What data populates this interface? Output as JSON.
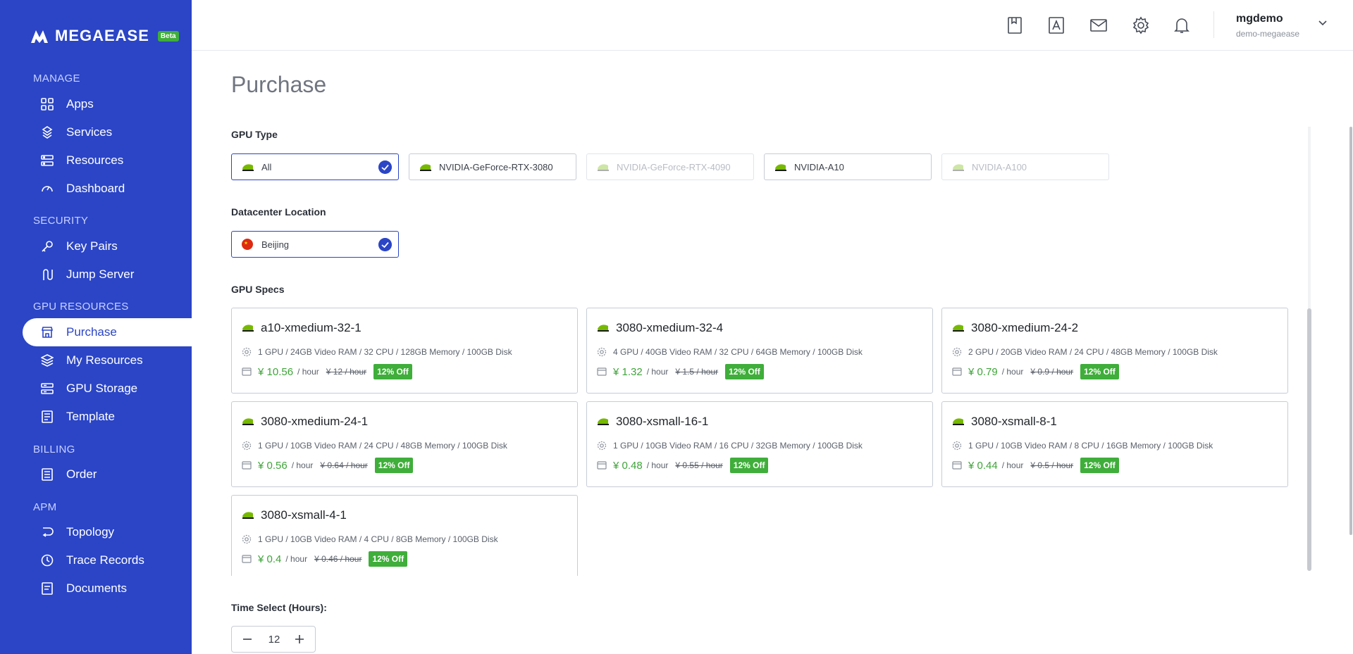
{
  "brand": {
    "name": "MEGAEASE",
    "badge": "Beta"
  },
  "sidebar": {
    "sections": [
      {
        "label": "MANAGE"
      },
      {
        "label": "SECURITY"
      },
      {
        "label": "GPU RESOURCES"
      },
      {
        "label": "BILLING"
      },
      {
        "label": "APM"
      }
    ],
    "items": [
      {
        "label": "Apps",
        "icon": "grid-icon"
      },
      {
        "label": "Services",
        "icon": "services-icon"
      },
      {
        "label": "Resources",
        "icon": "server-icon"
      },
      {
        "label": "Dashboard",
        "icon": "gauge-icon"
      },
      {
        "label": "Key Pairs",
        "icon": "key-icon"
      },
      {
        "label": "Jump Server",
        "icon": "jump-server-icon"
      },
      {
        "label": "Purchase",
        "icon": "store-icon",
        "active": true
      },
      {
        "label": "My Resources",
        "icon": "layers-icon"
      },
      {
        "label": "GPU Storage",
        "icon": "storage-icon"
      },
      {
        "label": "Template",
        "icon": "template-icon"
      },
      {
        "label": "Order",
        "icon": "order-icon"
      },
      {
        "label": "Topology",
        "icon": "topology-icon"
      },
      {
        "label": "Trace Records",
        "icon": "clock-icon"
      },
      {
        "label": "Documents",
        "icon": "document-icon"
      }
    ]
  },
  "header": {
    "icons": [
      "bookmark-icon",
      "contacts-icon",
      "mail-icon",
      "gear-icon",
      "bell-icon"
    ],
    "user": {
      "name": "mgdemo",
      "org": "demo-megaease"
    }
  },
  "main": {
    "title": "Purchase",
    "gpu_type": {
      "label": "GPU Type",
      "options": [
        {
          "label": "All",
          "selected": true,
          "disabled": false
        },
        {
          "label": "NVIDIA-GeForce-RTX-3080",
          "selected": false,
          "disabled": false
        },
        {
          "label": "NVIDIA-GeForce-RTX-4090",
          "selected": false,
          "disabled": true
        },
        {
          "label": "NVIDIA-A10",
          "selected": false,
          "disabled": false
        },
        {
          "label": "NVIDIA-A100",
          "selected": false,
          "disabled": true
        }
      ]
    },
    "location": {
      "label": "Datacenter Location",
      "options": [
        {
          "label": "Beijing",
          "selected": true
        }
      ]
    },
    "specs": {
      "label": "GPU Specs",
      "per": "/ hour",
      "items": [
        {
          "name": "a10-xmedium-32-1",
          "spec": "1 GPU / 24GB Video RAM / 32 CPU / 128GB Memory / 100GB Disk",
          "price": "¥ 10.56",
          "original": "¥ 12 / hour",
          "discount": "12% Off"
        },
        {
          "name": "3080-xmedium-32-4",
          "spec": "4 GPU / 40GB Video RAM / 32 CPU / 64GB Memory / 100GB Disk",
          "price": "¥ 1.32",
          "original": "¥ 1.5 / hour",
          "discount": "12% Off"
        },
        {
          "name": "3080-xmedium-24-2",
          "spec": "2 GPU / 20GB Video RAM / 24 CPU / 48GB Memory / 100GB Disk",
          "price": "¥ 0.79",
          "original": "¥ 0.9 / hour",
          "discount": "12% Off"
        },
        {
          "name": "3080-xmedium-24-1",
          "spec": "1 GPU / 10GB Video RAM / 24 CPU / 48GB Memory / 100GB Disk",
          "price": "¥ 0.56",
          "original": "¥ 0.64 / hour",
          "discount": "12% Off"
        },
        {
          "name": "3080-xsmall-16-1",
          "spec": "1 GPU / 10GB Video RAM / 16 CPU / 32GB Memory / 100GB Disk",
          "price": "¥ 0.48",
          "original": "¥ 0.55 / hour",
          "discount": "12% Off"
        },
        {
          "name": "3080-xsmall-8-1",
          "spec": "1 GPU / 10GB Video RAM / 8 CPU / 16GB Memory / 100GB Disk",
          "price": "¥ 0.44",
          "original": "¥ 0.5 / hour",
          "discount": "12% Off"
        },
        {
          "name": "3080-xsmall-4-1",
          "spec": "1 GPU / 10GB Video RAM / 4 CPU / 8GB Memory / 100GB Disk",
          "price": "¥ 0.4",
          "original": "¥ 0.46 / hour",
          "discount": "12% Off"
        }
      ]
    },
    "time": {
      "label": "Time Select (Hours):",
      "value": "12"
    }
  },
  "colors": {
    "sidebar": "#2b45c6",
    "accent": "#2b45c6",
    "price": "#3fa43a",
    "discount": "#3fae3a"
  }
}
